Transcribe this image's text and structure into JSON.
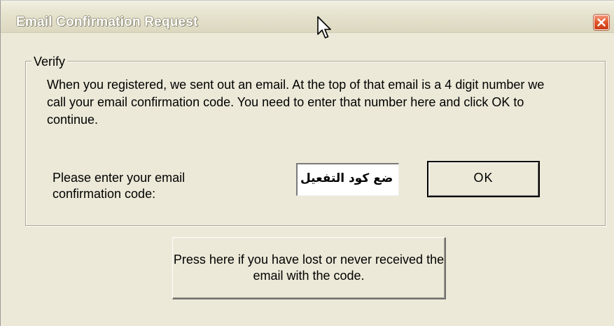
{
  "window": {
    "title": "Email Confirmation Request",
    "close_icon": "close-icon"
  },
  "verify_group": {
    "legend": "Verify",
    "info_text": "When you registered, we sent out an email.  At the top of that email is a 4 digit number we call your email confirmation code.  You need to enter that number here and click OK to continue."
  },
  "confirmation": {
    "prompt_label": "Please enter your email confirmation code:",
    "code_value": "ضع كود التفعيل",
    "ok_label": "OK"
  },
  "lost_email_button": {
    "label": "Press here if you have lost or never received the email with the code."
  },
  "colors": {
    "dialog_bg": "#ece9d8",
    "close_button": "#e2542a",
    "title_text": "#ffffff"
  }
}
